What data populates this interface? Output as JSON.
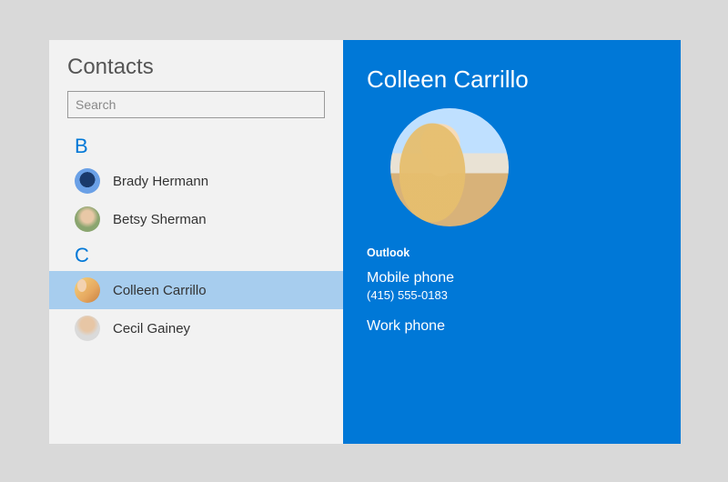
{
  "sidebar": {
    "title": "Contacts",
    "search_placeholder": "Search",
    "groups": [
      {
        "letter": "B",
        "items": [
          {
            "name": "Brady Hermann",
            "avatar": "av-brady",
            "selected": false
          },
          {
            "name": "Betsy Sherman",
            "avatar": "av-betsy",
            "selected": false
          }
        ]
      },
      {
        "letter": "C",
        "items": [
          {
            "name": "Colleen Carrillo",
            "avatar": "av-colleen-sm",
            "selected": true
          },
          {
            "name": "Cecil Gainey",
            "avatar": "av-cecil",
            "selected": false
          }
        ]
      }
    ]
  },
  "detail": {
    "name": "Colleen Carrillo",
    "source": "Outlook",
    "fields": [
      {
        "label": "Mobile phone",
        "value": "(415) 555-0183"
      },
      {
        "label": "Work phone",
        "value": ""
      }
    ]
  }
}
